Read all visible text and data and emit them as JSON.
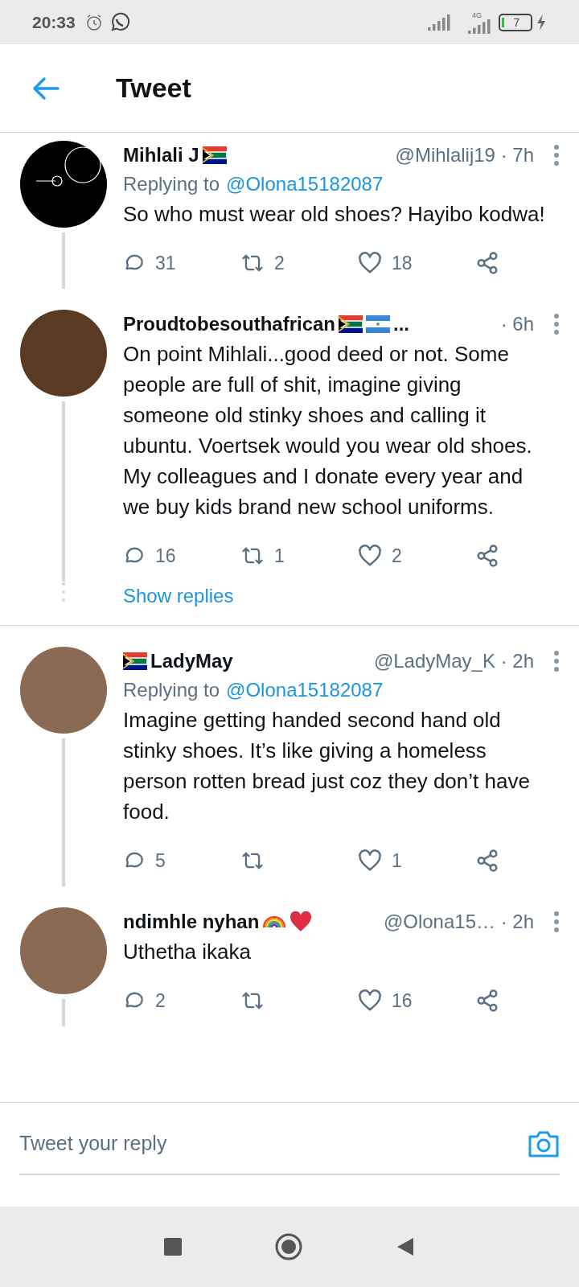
{
  "status_bar": {
    "time": "20:33",
    "network": "4G",
    "battery": "7"
  },
  "header": {
    "title": "Tweet"
  },
  "tweets": [
    {
      "kind": "drawing",
      "name": "Mihlali J",
      "badges": [
        {
          "kind": "flag-za"
        }
      ],
      "handle": "@Mihlalij19 · 7h",
      "replying_label": "Replying to",
      "replying_to": "@Olona15182087",
      "text": "So who must wear old shoes? Hayibo kodwa!",
      "replies": "31",
      "retweets": "2",
      "likes": "18",
      "divider_after": false
    },
    {
      "kind": "cartoon",
      "name": "Proudtobesouthafrican",
      "badges": [
        {
          "kind": "flag-za"
        },
        {
          "kind": "flag-ni"
        }
      ],
      "name_suffix": "...",
      "handle": "· 6h",
      "text": "On point Mihlali...good deed or not. Some people are full of shit, imagine giving someone old stinky shoes and calling it ubuntu. Voertsek would you wear old shoes. My colleagues and I donate every year and we buy kids brand new school uniforms.",
      "replies": "16",
      "retweets": "1",
      "likes": "2",
      "show_replies": "Show replies",
      "divider_after": true
    },
    {
      "kind": "photo",
      "name": "LadyMay",
      "badges_before": [
        {
          "kind": "flag-za"
        }
      ],
      "handle": "@LadyMay_K · 2h",
      "replying_label": "Replying to",
      "replying_to": "@Olona15182087",
      "text": "Imagine getting handed second hand old stinky shoes. It’s like giving a homeless person rotten bread just coz they don’t have food.",
      "replies": "5",
      "likes": "1",
      "divider_after": false
    },
    {
      "kind": "photo",
      "name": "ndimhle nyhan",
      "badges": [
        {
          "kind": "rainbow"
        },
        {
          "kind": "heart"
        }
      ],
      "handle": "@Olona15… · 2h",
      "text": "Uthetha ikaka",
      "replies": "2",
      "likes": "16",
      "divider_after": false
    }
  ],
  "reply_bar": {
    "placeholder": "Tweet your reply"
  }
}
